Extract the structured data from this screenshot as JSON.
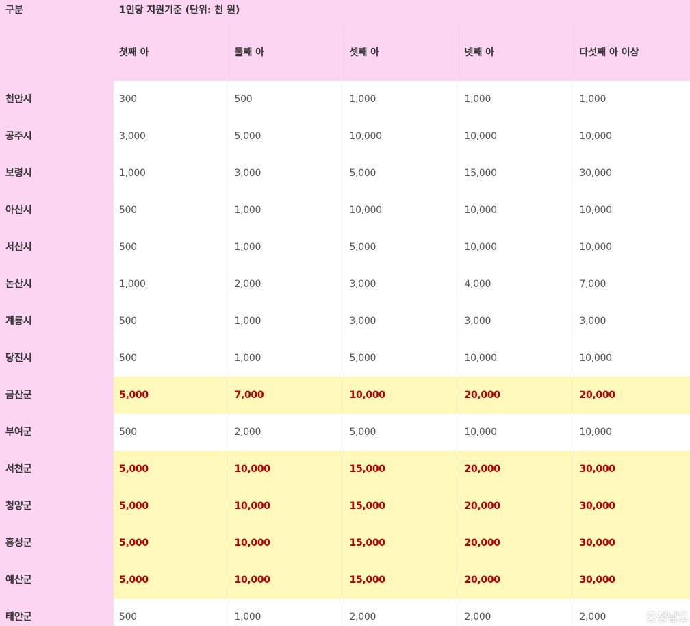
{
  "header": {
    "category_label": "구분",
    "group_label": "1인당 지원기준 (단위: 천 원)",
    "columns": [
      "첫째 아",
      "둘째 아",
      "셋째 아",
      "넷째 아",
      "다섯째 아 이상"
    ]
  },
  "rows": [
    {
      "region": "천안시",
      "values": [
        "300",
        "500",
        "1,000",
        "1,000",
        "1,000"
      ],
      "highlighted": false
    },
    {
      "region": "공주시",
      "values": [
        "3,000",
        "5,000",
        "10,000",
        "10,000",
        "10,000"
      ],
      "highlighted": false
    },
    {
      "region": "보령시",
      "values": [
        "1,000",
        "3,000",
        "5,000",
        "15,000",
        "30,000"
      ],
      "highlighted": false
    },
    {
      "region": "아산시",
      "values": [
        "500",
        "1,000",
        "10,000",
        "10,000",
        "10,000"
      ],
      "highlighted": false
    },
    {
      "region": "서산시",
      "values": [
        "500",
        "1,000",
        "5,000",
        "10,000",
        "10,000"
      ],
      "highlighted": false
    },
    {
      "region": "논산시",
      "values": [
        "1,000",
        "2,000",
        "3,000",
        "4,000",
        "7,000"
      ],
      "highlighted": false
    },
    {
      "region": "계룡시",
      "values": [
        "500",
        "1,000",
        "3,000",
        "3,000",
        "3,000"
      ],
      "highlighted": false
    },
    {
      "region": "당진시",
      "values": [
        "500",
        "1,000",
        "5,000",
        "10,000",
        "10,000"
      ],
      "highlighted": false
    },
    {
      "region": "금산군",
      "values": [
        "5,000",
        "7,000",
        "10,000",
        "20,000",
        "20,000"
      ],
      "highlighted": true
    },
    {
      "region": "부여군",
      "values": [
        "500",
        "2,000",
        "5,000",
        "10,000",
        "10,000"
      ],
      "highlighted": false
    },
    {
      "region": "서천군",
      "values": [
        "5,000",
        "10,000",
        "15,000",
        "20,000",
        "30,000"
      ],
      "highlighted": true
    },
    {
      "region": "청양군",
      "values": [
        "5,000",
        "10,000",
        "15,000",
        "20,000",
        "30,000"
      ],
      "highlighted": true
    },
    {
      "region": "홍성군",
      "values": [
        "5,000",
        "10,000",
        "15,000",
        "20,000",
        "30,000"
      ],
      "highlighted": true
    },
    {
      "region": "예산군",
      "values": [
        "5,000",
        "10,000",
        "15,000",
        "20,000",
        "30,000"
      ],
      "highlighted": true
    },
    {
      "region": "태안군",
      "values": [
        "500",
        "1,000",
        "2,000",
        "2,000",
        "2,000"
      ],
      "highlighted": false
    }
  ],
  "colors": {
    "header_bg": "#fcd5f2",
    "highlight_bg": "#fff8bb",
    "highlight_text": "#b00000"
  },
  "watermark": {
    "icon": "logo-mark",
    "text": "충청남도"
  }
}
